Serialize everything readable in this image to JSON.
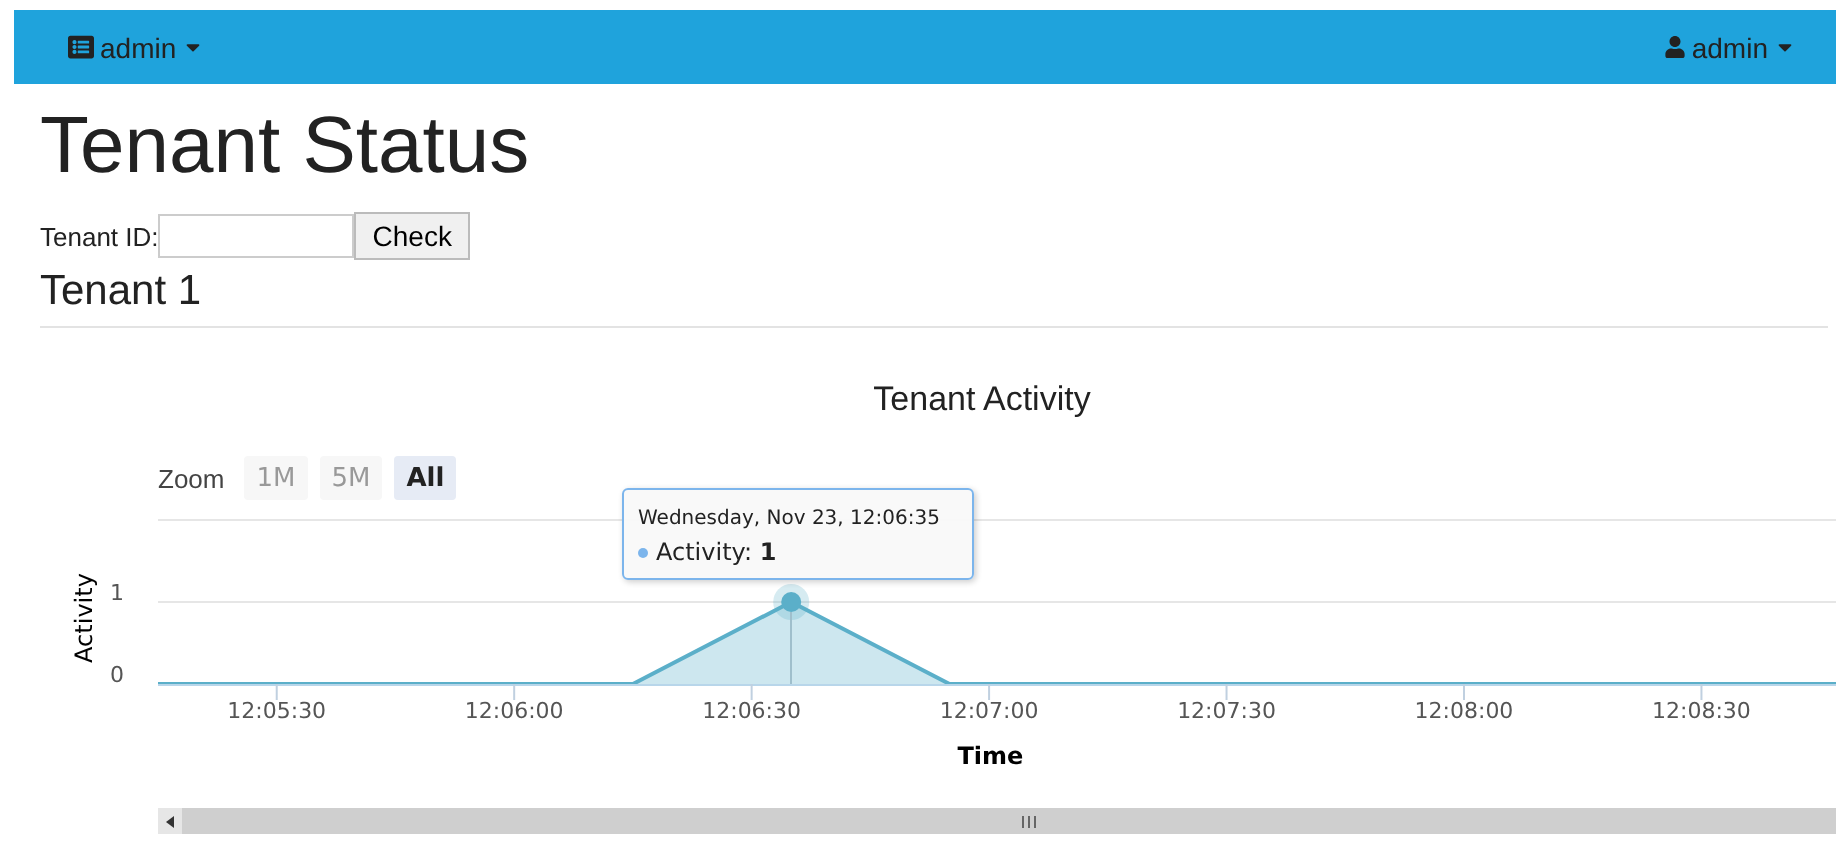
{
  "navbar": {
    "left_menu": {
      "label": "admin"
    },
    "right_menu": {
      "label": "admin"
    }
  },
  "page": {
    "title": "Tenant Status",
    "form": {
      "label": "Tenant ID:",
      "button": "Check"
    },
    "subtitle": "Tenant 1"
  },
  "chart": {
    "zoom_label": "Zoom",
    "zoom_buttons": [
      {
        "label": "1M",
        "selected": false,
        "disabled": true
      },
      {
        "label": "5M",
        "selected": false,
        "disabled": true
      },
      {
        "label": "All",
        "selected": true,
        "disabled": false
      }
    ],
    "tooltip": {
      "title": "Wednesday, Nov 23, 12:06:35",
      "value": "Activity: **1**",
      "color": "#7cb5ec"
    },
    "chart_data": {
      "type": "area",
      "title": "Tenant Activity",
      "xlabel": "Time",
      "ylabel": "Activity",
      "series": [
        {
          "color": "#5bafc9",
          "values": [
            0,
            0,
            1,
            0,
            0
          ]
        }
      ],
      "x": [
        43515,
        43575,
        43595,
        43615,
        43727
      ],
      "xlim": [
        43515,
        43727
      ],
      "ylim": [
        0,
        2
      ],
      "xticks": [
        {
          "value": 43530,
          "label": "12:05:30"
        },
        {
          "value": 43560,
          "label": "12:06:00"
        },
        {
          "value": 43590,
          "label": "12:06:30"
        },
        {
          "value": 43620,
          "label": "12:07:00"
        },
        {
          "value": 43650,
          "label": "12:07:30"
        },
        {
          "value": 43680,
          "label": "12:08:00"
        },
        {
          "value": 43710,
          "label": "12:08:30"
        }
      ],
      "yticks": [
        0,
        1
      ]
    }
  }
}
